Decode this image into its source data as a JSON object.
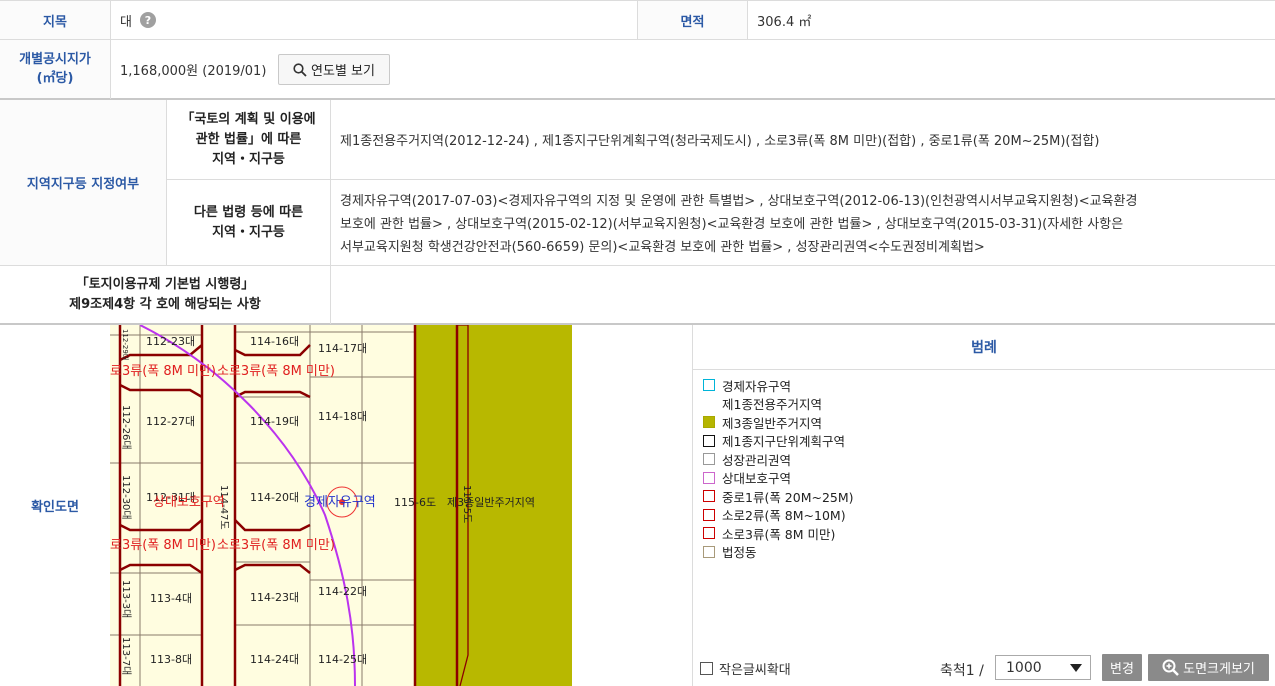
{
  "land": {
    "category_label": "지목",
    "category_value": "대",
    "area_label": "면적",
    "area_value": "306.4 ㎡",
    "price_label_1": "개별공시지가",
    "price_label_2": "(㎡당)",
    "price_value": "1,168,000원 (2019/01)",
    "year_button": "연도별 보기"
  },
  "zoning": {
    "section_label": "지역지구등 지정여부",
    "national_label_1": "「국토의 계획 및 이용에",
    "national_label_2": "관한 법률」에 따른",
    "national_label_3": "지역・지구등",
    "national_value": "제1종전용주거지역(2012-12-24) , 제1종지구단위계획구역(청라국제도시) , 소로3류(폭 8M 미만)(접합) , 중로1류(폭 20M~25M)(접합)",
    "other_label_1": "다른 법령 등에 따른",
    "other_label_2": "지역・지구등",
    "other_value_1": "경제자유구역(2017-07-03)<경제자유구역의 지정 및 운영에 관한 특별법> , 상대보호구역(2012-06-13)(인천광역시서부교육지원청)<교육환경",
    "other_value_2": "보호에 관한 법률> , 상대보호구역(2015-02-12)(서부교육지원청)<교육환경 보호에 관한 법률> , 상대보호구역(2015-03-31)(자세한 사항은",
    "other_value_3": "서부교육지원청 학생건강안전과(560-6659) 문의)<교육환경 보호에 관한 법률> , 성장관리권역<수도권정비계획법>"
  },
  "regulation": {
    "label_1": "「토지이용규제 기본법 시행령」",
    "label_2": "제9조제4항 각 호에 해당되는 사항",
    "value": ""
  },
  "map": {
    "label": "확인도면",
    "parcels": {
      "p1": "112-23대",
      "p2": "114-16대",
      "p3": "114-17대",
      "p4": "112-27대",
      "p5": "114-19대",
      "p6": "114-18대",
      "p7": "112-31대",
      "p8": "114-20대",
      "p9": "115-6도",
      "p10": "113-4대",
      "p11": "114-23대",
      "p12": "114-22대",
      "p13": "113-8대",
      "p14": "114-24대",
      "p15": "114-25대",
      "v1": "112-26대",
      "v2": "112-30대",
      "v3": "113-3대",
      "v4": "113-7대",
      "v5": "114-47도",
      "v6": "115-5도",
      "v7": "112-29대"
    },
    "labels": {
      "road_a": "로3류(폭 8M 미만)",
      "road_b": "소로3류(폭 8M 미만)",
      "road_c": "로3류(폭 8M 미만)",
      "road_d": "소로3류(폭 8M 미만)",
      "protect": "상대보호구역",
      "econ": "경제자유구역",
      "zone3": "제3종일반주거지역"
    }
  },
  "legend": {
    "title": "범례",
    "items": [
      {
        "label": "경제자유구역",
        "color": "#00b4d8",
        "fill": "#ffffff"
      },
      {
        "label": "제1종전용주거지역",
        "color": "#ffffff",
        "fill": "#ffffff"
      },
      {
        "label": "제3종일반주거지역",
        "color": "#a8a800",
        "fill": "#b5b500"
      },
      {
        "label": "제1종지구단위계획구역",
        "color": "#111111",
        "fill": "#ffffff"
      },
      {
        "label": "성장관리권역",
        "color": "#999999",
        "fill": "#ffffff"
      },
      {
        "label": "상대보호구역",
        "color": "#cc66cc",
        "fill": "#ffffff"
      },
      {
        "label": "중로1류(폭 20M~25M)",
        "color": "#cc0000",
        "fill": "#ffffff"
      },
      {
        "label": "소로2류(폭 8M~10M)",
        "color": "#cc0000",
        "fill": "#ffffff"
      },
      {
        "label": "소로3류(폭 8M 미만)",
        "color": "#cc0000",
        "fill": "#ffffff"
      },
      {
        "label": "법정동",
        "color": "#a89a7a",
        "fill": "#ffffff"
      }
    ]
  },
  "controls": {
    "small_text_label": "작은글씨확대",
    "scale_label": "축척1 /",
    "scale_value": "1000",
    "change_button": "변경",
    "big_map_button": "도면크게보기"
  }
}
